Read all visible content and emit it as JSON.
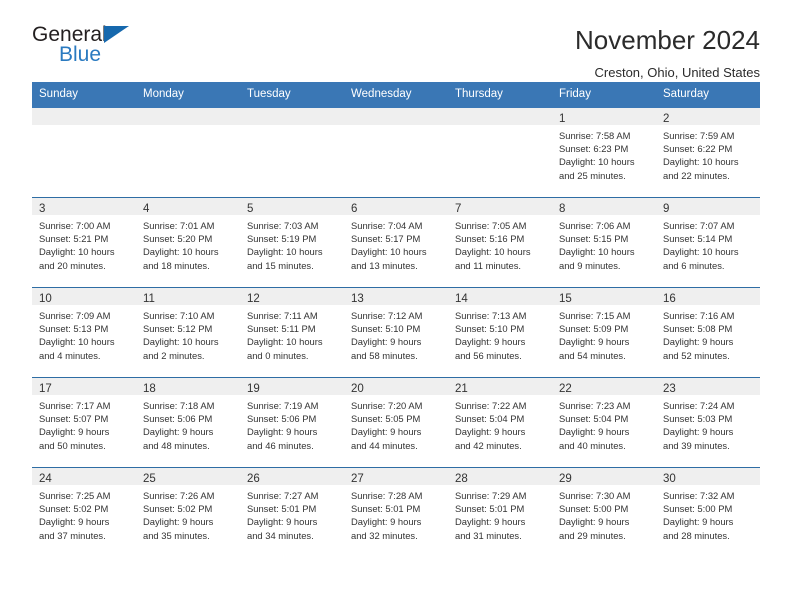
{
  "brand": {
    "name_part1": "General",
    "name_part2": "Blue",
    "triangle_color": "#1668ad",
    "blue_text_color": "#2a7ac0"
  },
  "header": {
    "title": "November 2024",
    "subtitle": "Creston, Ohio, United States",
    "header_bg_color": "#3a77b5",
    "row_separator_color": "#2e6da4",
    "daynum_band_color": "#efefef"
  },
  "calendar": {
    "weekday_headers": [
      "Sunday",
      "Monday",
      "Tuesday",
      "Wednesday",
      "Thursday",
      "Friday",
      "Saturday"
    ],
    "weeks": [
      [
        {
          "day": "",
          "lines": []
        },
        {
          "day": "",
          "lines": []
        },
        {
          "day": "",
          "lines": []
        },
        {
          "day": "",
          "lines": []
        },
        {
          "day": "",
          "lines": []
        },
        {
          "day": "1",
          "lines": [
            "Sunrise: 7:58 AM",
            "Sunset: 6:23 PM",
            "Daylight: 10 hours",
            "and 25 minutes."
          ]
        },
        {
          "day": "2",
          "lines": [
            "Sunrise: 7:59 AM",
            "Sunset: 6:22 PM",
            "Daylight: 10 hours",
            "and 22 minutes."
          ]
        }
      ],
      [
        {
          "day": "3",
          "lines": [
            "Sunrise: 7:00 AM",
            "Sunset: 5:21 PM",
            "Daylight: 10 hours",
            "and 20 minutes."
          ]
        },
        {
          "day": "4",
          "lines": [
            "Sunrise: 7:01 AM",
            "Sunset: 5:20 PM",
            "Daylight: 10 hours",
            "and 18 minutes."
          ]
        },
        {
          "day": "5",
          "lines": [
            "Sunrise: 7:03 AM",
            "Sunset: 5:19 PM",
            "Daylight: 10 hours",
            "and 15 minutes."
          ]
        },
        {
          "day": "6",
          "lines": [
            "Sunrise: 7:04 AM",
            "Sunset: 5:17 PM",
            "Daylight: 10 hours",
            "and 13 minutes."
          ]
        },
        {
          "day": "7",
          "lines": [
            "Sunrise: 7:05 AM",
            "Sunset: 5:16 PM",
            "Daylight: 10 hours",
            "and 11 minutes."
          ]
        },
        {
          "day": "8",
          "lines": [
            "Sunrise: 7:06 AM",
            "Sunset: 5:15 PM",
            "Daylight: 10 hours",
            "and 9 minutes."
          ]
        },
        {
          "day": "9",
          "lines": [
            "Sunrise: 7:07 AM",
            "Sunset: 5:14 PM",
            "Daylight: 10 hours",
            "and 6 minutes."
          ]
        }
      ],
      [
        {
          "day": "10",
          "lines": [
            "Sunrise: 7:09 AM",
            "Sunset: 5:13 PM",
            "Daylight: 10 hours",
            "and 4 minutes."
          ]
        },
        {
          "day": "11",
          "lines": [
            "Sunrise: 7:10 AM",
            "Sunset: 5:12 PM",
            "Daylight: 10 hours",
            "and 2 minutes."
          ]
        },
        {
          "day": "12",
          "lines": [
            "Sunrise: 7:11 AM",
            "Sunset: 5:11 PM",
            "Daylight: 10 hours",
            "and 0 minutes."
          ]
        },
        {
          "day": "13",
          "lines": [
            "Sunrise: 7:12 AM",
            "Sunset: 5:10 PM",
            "Daylight: 9 hours",
            "and 58 minutes."
          ]
        },
        {
          "day": "14",
          "lines": [
            "Sunrise: 7:13 AM",
            "Sunset: 5:10 PM",
            "Daylight: 9 hours",
            "and 56 minutes."
          ]
        },
        {
          "day": "15",
          "lines": [
            "Sunrise: 7:15 AM",
            "Sunset: 5:09 PM",
            "Daylight: 9 hours",
            "and 54 minutes."
          ]
        },
        {
          "day": "16",
          "lines": [
            "Sunrise: 7:16 AM",
            "Sunset: 5:08 PM",
            "Daylight: 9 hours",
            "and 52 minutes."
          ]
        }
      ],
      [
        {
          "day": "17",
          "lines": [
            "Sunrise: 7:17 AM",
            "Sunset: 5:07 PM",
            "Daylight: 9 hours",
            "and 50 minutes."
          ]
        },
        {
          "day": "18",
          "lines": [
            "Sunrise: 7:18 AM",
            "Sunset: 5:06 PM",
            "Daylight: 9 hours",
            "and 48 minutes."
          ]
        },
        {
          "day": "19",
          "lines": [
            "Sunrise: 7:19 AM",
            "Sunset: 5:06 PM",
            "Daylight: 9 hours",
            "and 46 minutes."
          ]
        },
        {
          "day": "20",
          "lines": [
            "Sunrise: 7:20 AM",
            "Sunset: 5:05 PM",
            "Daylight: 9 hours",
            "and 44 minutes."
          ]
        },
        {
          "day": "21",
          "lines": [
            "Sunrise: 7:22 AM",
            "Sunset: 5:04 PM",
            "Daylight: 9 hours",
            "and 42 minutes."
          ]
        },
        {
          "day": "22",
          "lines": [
            "Sunrise: 7:23 AM",
            "Sunset: 5:04 PM",
            "Daylight: 9 hours",
            "and 40 minutes."
          ]
        },
        {
          "day": "23",
          "lines": [
            "Sunrise: 7:24 AM",
            "Sunset: 5:03 PM",
            "Daylight: 9 hours",
            "and 39 minutes."
          ]
        }
      ],
      [
        {
          "day": "24",
          "lines": [
            "Sunrise: 7:25 AM",
            "Sunset: 5:02 PM",
            "Daylight: 9 hours",
            "and 37 minutes."
          ]
        },
        {
          "day": "25",
          "lines": [
            "Sunrise: 7:26 AM",
            "Sunset: 5:02 PM",
            "Daylight: 9 hours",
            "and 35 minutes."
          ]
        },
        {
          "day": "26",
          "lines": [
            "Sunrise: 7:27 AM",
            "Sunset: 5:01 PM",
            "Daylight: 9 hours",
            "and 34 minutes."
          ]
        },
        {
          "day": "27",
          "lines": [
            "Sunrise: 7:28 AM",
            "Sunset: 5:01 PM",
            "Daylight: 9 hours",
            "and 32 minutes."
          ]
        },
        {
          "day": "28",
          "lines": [
            "Sunrise: 7:29 AM",
            "Sunset: 5:01 PM",
            "Daylight: 9 hours",
            "and 31 minutes."
          ]
        },
        {
          "day": "29",
          "lines": [
            "Sunrise: 7:30 AM",
            "Sunset: 5:00 PM",
            "Daylight: 9 hours",
            "and 29 minutes."
          ]
        },
        {
          "day": "30",
          "lines": [
            "Sunrise: 7:32 AM",
            "Sunset: 5:00 PM",
            "Daylight: 9 hours",
            "and 28 minutes."
          ]
        }
      ]
    ]
  }
}
